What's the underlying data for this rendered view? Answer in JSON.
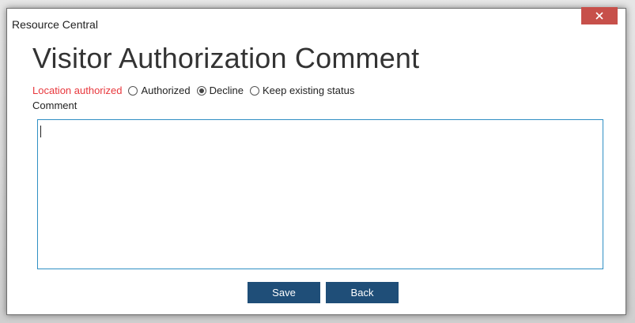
{
  "window": {
    "title": "Resource Central"
  },
  "dialog": {
    "heading": "Visitor Authorization Comment",
    "status_label": "Location authorized",
    "options": [
      {
        "label": "Authorized",
        "checked": false
      },
      {
        "label": "Decline",
        "checked": true
      },
      {
        "label": "Keep existing status",
        "checked": false
      }
    ],
    "comment_label": "Comment",
    "comment_value": ""
  },
  "buttons": {
    "save_label": "Save",
    "back_label": "Back"
  },
  "colors": {
    "accent_button": "#1f4e78",
    "close_button": "#c7504a",
    "label_red": "#e8383d",
    "input_border": "#2f8fc4"
  }
}
